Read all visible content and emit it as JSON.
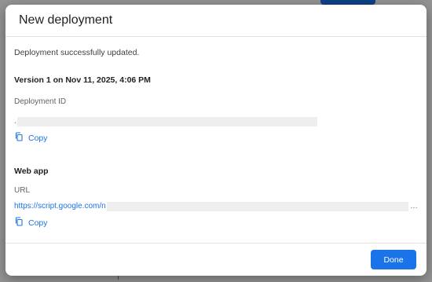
{
  "dialog": {
    "title": "New deployment",
    "status_message": "Deployment successfully updated.",
    "version_line": "Version 1 on Nov 11, 2025, 4:06 PM",
    "deployment_id": {
      "label": "Deployment ID",
      "value_prefix": ".",
      "copy_label": "Copy",
      "copy_icon": "copy-icon"
    },
    "web_app": {
      "heading": "Web app",
      "url_label": "URL",
      "url_visible": "https://script.google.com/n",
      "url_ellipsis": "…",
      "copy_label": "Copy",
      "copy_icon": "copy-icon"
    },
    "done_label": "Done"
  },
  "colors": {
    "accent": "#1a73e8",
    "redaction": "#eeeeee"
  }
}
